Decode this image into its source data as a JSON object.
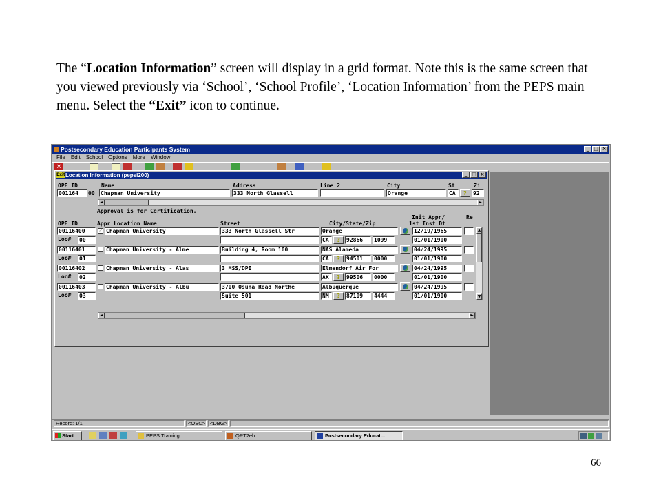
{
  "intro": {
    "p1": "The “",
    "b1": "Location Information",
    "p2": "” screen will display in a grid format.  Note this is the same screen that you viewed previously via ‘School’, ‘School Profile’, ‘Location Information’ from the PEPS main menu.  Select the ",
    "b2": "“Exit”",
    "p3": " icon to continue."
  },
  "page_number": "66",
  "app": {
    "title": "Postsecondary Education Participants System",
    "menu": [
      "File",
      "Edit",
      "School",
      "Options",
      "More",
      "Window"
    ]
  },
  "child": {
    "title": "Location Information (pepsi200)",
    "exit_icon": "Exit",
    "header_labels": {
      "ope_id": "OPE ID",
      "name": "Name",
      "address": "Address",
      "line2": "Line 2",
      "city": "City",
      "st": "St",
      "zip": "Zi"
    },
    "header_values": {
      "ope_id": "001164",
      "ope_sfx": "00",
      "name": "Chapman University",
      "address": "333 North Glassell",
      "line2": "",
      "city": "Orange",
      "st": "CA",
      "zip": "92"
    },
    "approval_note": "Approval is for Certification.",
    "grid_labels": {
      "init_appr": "Init Appr/",
      "re": "Re",
      "ope_id": "OPE ID",
      "appr_loc": "Appr  Location Name",
      "street": "Street",
      "city_state_zip": "City/State/Zip",
      "inst_dt": "1st Inst Dt",
      "loc": "Loc#"
    },
    "rows": [
      {
        "ope": "00116400",
        "checked": "✓",
        "loc": "00",
        "name": "Chapman University",
        "street1": "333 North Glassell Str",
        "street2": "",
        "city": "Orange",
        "state": "CA",
        "zip": "92866",
        "zip4": "1099",
        "date1": "12/19/1965",
        "date2": "01/01/1900"
      },
      {
        "ope": "00116401",
        "checked": "",
        "loc": "01",
        "name": "Chapman University - Alme",
        "street1": "Building 4, Room 100",
        "street2": "",
        "city": "NAS Alameda",
        "state": "CA",
        "zip": "94501",
        "zip4": "0000",
        "date1": "04/24/1995",
        "date2": "01/01/1900"
      },
      {
        "ope": "00116402",
        "checked": "",
        "loc": "02",
        "name": "Chapman University - Alas",
        "street1": "3 MSS/DPE",
        "street2": "",
        "city": "Elmendorf Air For",
        "state": "AK",
        "zip": "99506",
        "zip4": "0000",
        "date1": "04/24/1995",
        "date2": "01/01/1900"
      },
      {
        "ope": "00116403",
        "checked": "",
        "loc": "03",
        "name": "Chapman University - Albu",
        "street1": "3700 Osuna Road Northe",
        "street2": "Suite 501",
        "city": "Albuquerque",
        "state": "NM",
        "zip": "87109",
        "zip4": "4444",
        "date1": "04/24/1995",
        "date2": "01/01/1900"
      }
    ]
  },
  "status": {
    "record": "Record: 1/1",
    "osc": "<OSC>",
    "dbg": "<DBG>"
  },
  "taskbar": {
    "start": "Start",
    "tasks": [
      "PEPS Training",
      "QRT2eb",
      "Postsecondary Educat..."
    ]
  },
  "colors": {
    "title_bar": "#0a2a8a",
    "window_face": "#c0c0c0",
    "desktop_gray": "#808080"
  }
}
